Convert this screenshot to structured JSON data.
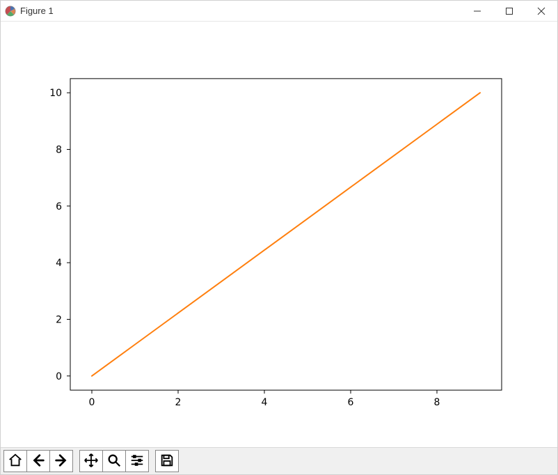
{
  "window": {
    "title": "Figure 1"
  },
  "chart_data": {
    "type": "line",
    "x": [
      0,
      1,
      2,
      3,
      4,
      5,
      6,
      7,
      8,
      9
    ],
    "y": [
      0,
      1.111,
      2.222,
      3.333,
      4.444,
      5.556,
      6.667,
      7.778,
      8.889,
      10
    ],
    "xticks": [
      0,
      2,
      4,
      6,
      8
    ],
    "yticks": [
      0,
      2,
      4,
      6,
      8,
      10
    ],
    "xlim": [
      -0.5,
      9.5
    ],
    "ylim": [
      -0.5,
      10.5
    ],
    "title": "",
    "xlabel": "",
    "ylabel": "",
    "line_color": "#ff7f0e"
  },
  "toolbar": {
    "home": "Home",
    "back": "Back",
    "forward": "Forward",
    "pan": "Pan",
    "zoom": "Zoom",
    "configure": "Configure subplots",
    "save": "Save"
  },
  "win_controls": {
    "minimize": "Minimize",
    "maximize": "Maximize",
    "close": "Close"
  }
}
